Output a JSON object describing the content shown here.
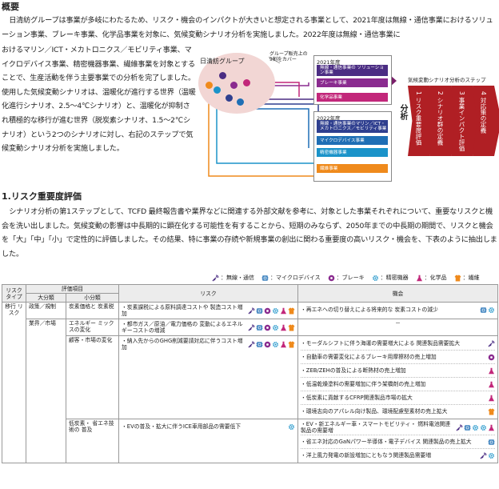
{
  "overview": {
    "heading": "概要",
    "intro": "日清紡グループは事業が多岐にわたるため、リスク・機会のインパクトが大きいと想定される事業として、2021年度は無線・通信事業におけるソリューション事業、ブレーキ事業、化学品事業を対象に、気候変動シナリオ分析を実施しました。2022年度は無線・通信事業に",
    "left_text": "おけるマリン／ICT・メカトロニクス／モビリティ事業、マイクロデバイス事業、精密機器事業、繊維事業を対象とすることで、生産活動を伴う主要事業での分析を完了しました。使用した気候変動シナリオは、温暖化が進行する世界（温暖化進行シナリオ、2.5～4℃シナリオ）と、温暖化が抑制され積極的な移行が進む世界（脱炭素シナリオ、1.5～2℃シナリオ）という2つのシナリオに対し、右記のステップで気候変動シナリオ分析を実施しました。"
  },
  "diagram": {
    "group_label": "日清紡グループ",
    "callout": "グループ販売上の9割をカバー",
    "box_2021": {
      "title": "2021年度",
      "items": [
        {
          "label": "無線・通信事業の ソリューション事業",
          "color": "#4b2d83"
        },
        {
          "label": "ブレーキ事業",
          "color": "#8a2b8f"
        },
        {
          "label": "化学品事業",
          "color": "#c2277a"
        }
      ]
    },
    "box_2022": {
      "title": "2022年度",
      "items": [
        {
          "label": "無線・通信事業のマリン／ICT・ メカトロニクス／モビリティ事業",
          "color": "#2f3f8f"
        },
        {
          "label": "マイクロデバイス事業",
          "color": "#1f6fb5"
        },
        {
          "label": "精密機器事業",
          "color": "#1b93c9"
        },
        {
          "label": "繊維事業",
          "color": "#ef8a1c"
        }
      ]
    },
    "analysis_label": "分析",
    "steps_title": "気候変動シナリオ分析のステップ",
    "steps": [
      "1 リスク重要度評価",
      "2 シナリオ群の定義",
      "3 事業インパクト評価",
      "4 対応策の定義"
    ]
  },
  "section1": {
    "heading": "1.リスク重要度評価",
    "body": "シナリオ分析の第1ステップとして、TCFD 最終報告書や業界などに関連する外部文献を参考に、対象とした事業それぞれについて、重要なリスクと機会を洗い出しました。気候変動の影響は中長期的に顕在化する可能性を有することから、短期のみならず、2050年までの中長期の期間で、リスクと機会を「大」「中」「小」で定性的に評価しました。その結果、特に事業の存続や新規事業の創出に関わる重要度の高いリスク・機会を、下表のように抽出しました。"
  },
  "legend": [
    {
      "icon": "wireless-icon",
      "label": "：無線・通信",
      "color": "#4b2d83"
    },
    {
      "icon": "microdevice-icon",
      "label": "：マイクロデバイス",
      "color": "#1f6fb5"
    },
    {
      "icon": "brake-icon",
      "label": "：ブレーキ",
      "color": "#8a2b8f"
    },
    {
      "icon": "gear-icon",
      "label": "：精密機器",
      "color": "#1b93c9"
    },
    {
      "icon": "flask-icon",
      "label": "：化学品",
      "color": "#c2277a"
    },
    {
      "icon": "textile-icon",
      "label": "：繊維",
      "color": "#ef8a1c"
    }
  ],
  "table": {
    "headers": {
      "risk_type": "リスク タイプ",
      "eval_item": "評価項目",
      "major": "大分類",
      "minor": "小分類",
      "risk": "リスク",
      "opportunity": "機会"
    },
    "risk_type_value": "移行 リスク",
    "rows": [
      {
        "major": "政策／規制",
        "minor": "炭素価格と 炭素税",
        "risks": [
          {
            "text": "・炭素課税による原料調達コストや 製造コスト増加",
            "icons": [
              "wireless",
              "microdevice",
              "brake",
              "gear",
              "flask",
              "textile"
            ]
          }
        ],
        "opps": [
          {
            "text": "・再エネへの切り替えによる将来的な 炭素コストの減少",
            "icons": [
              "microdevice",
              "gear"
            ]
          }
        ]
      },
      {
        "major": "業界／市場",
        "minor": "エネルギー ミックスの変化",
        "risks": [
          {
            "text": "・都市ガス／原油／電力価格の 変動によるエネルギーコストの増減",
            "icons": [
              "wireless",
              "microdevice",
              "brake",
              "gear",
              "flask",
              "textile"
            ]
          }
        ],
        "opps": [
          {
            "text": "－",
            "icons": []
          }
        ]
      },
      {
        "major": "",
        "minor": "顧客・市場の変化",
        "risks": [
          {
            "text": "・納入先からのGHG削減要請対応に伴うコスト増加",
            "icons": [
              "wireless",
              "microdevice",
              "brake",
              "gear",
              "flask",
              "textile"
            ]
          }
        ],
        "opps": [
          {
            "text": "・モーダルシフトに伴う海運の需要増大による 関連製品需要拡大",
            "icons": [
              "wireless"
            ]
          },
          {
            "text": "・自動車の需要変化によるブレーキ用摩擦材の売上増加",
            "icons": [
              "brake"
            ]
          },
          {
            "text": "・ZEB/ZEHの普及による断熱材の売上増加",
            "icons": [
              "flask"
            ]
          },
          {
            "text": "・低温乾燥塗料の需要増加に伴う架橋剤の売上増加",
            "icons": [
              "flask"
            ]
          },
          {
            "text": "・低炭素に貢献するCFRP関連製品市場の拡大",
            "icons": [
              "flask"
            ]
          },
          {
            "text": "・環境志向のアパレル向け製品、環境配慮型素材の売上拡大",
            "icons": [
              "textile"
            ]
          }
        ]
      },
      {
        "major": "",
        "minor": "低炭素・ 省エネ技術の 普及",
        "risks": [
          {
            "text": "・EVの普及・拡大に伴うICE車用部品の需要低下",
            "icons": [
              "gear"
            ]
          }
        ],
        "opps": [
          {
            "text": "・EV・新エネルギー車・スマートモビリティ・ 燃料電池関連製品の需要増",
            "icons": [
              "wireless",
              "microdevice",
              "gear",
              "gear",
              "flask"
            ]
          },
          {
            "text": "・省エネ対応のGaNパワー半導体・電子デバイス 関連製品の売上拡大",
            "icons": [
              "microdevice"
            ]
          },
          {
            "text": "・洋上風力発電の新設増加にともなう関連製品需要増",
            "icons": [
              "wireless",
              "gear"
            ]
          }
        ]
      }
    ]
  }
}
